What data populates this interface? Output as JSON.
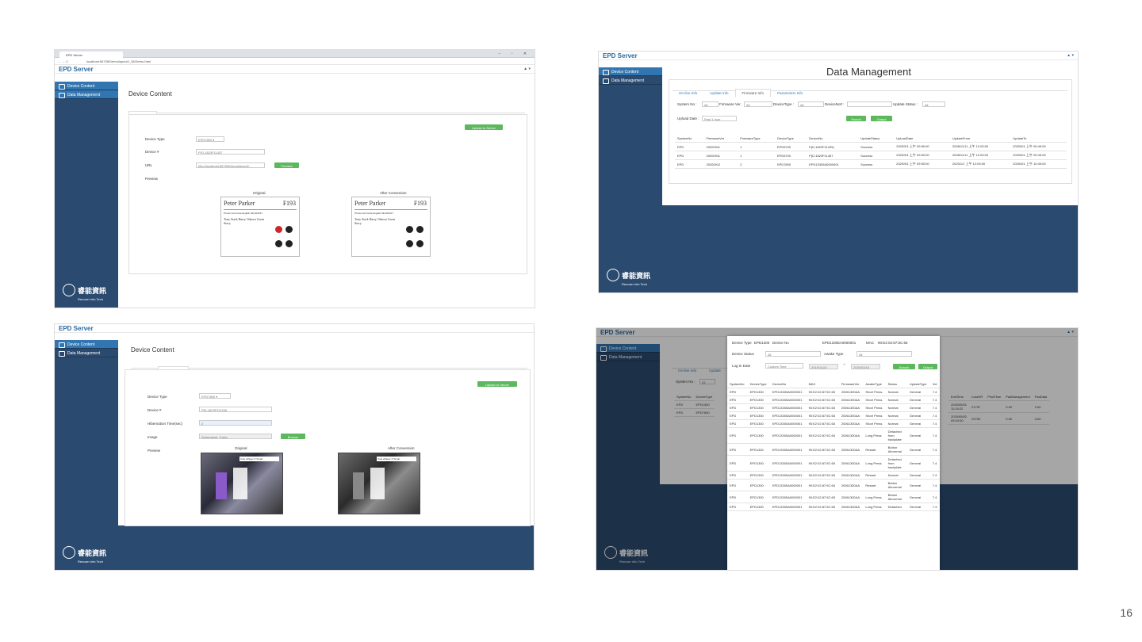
{
  "shot1": {
    "tab_title": "EPD Server",
    "url": "localhost:56759/Demo/layout2_28/Demo.html",
    "window_controls": "− ▫ ✕",
    "brand": "EPD Server",
    "user_icon": "▲ ▾",
    "sidebar": [
      "Device Content",
      "Data Management"
    ],
    "title": "Device Content",
    "tabs": [
      "By HTTP",
      "By IMAGE"
    ],
    "upload_button": "Upload to Server",
    "labels": [
      "Device Type",
      "Device #",
      "URL",
      "Preview"
    ],
    "device_type": "EPD7800 ▾",
    "device_no": "P(D-1823F11457",
    "url_value": "http://localhost:56759/Demo/layout2...",
    "preview_button": "Preview",
    "original_caption": "Original",
    "after_caption": "After Conversion",
    "card": {
      "name": "Peter Parker",
      "number": "₣193",
      "row_text": "Ph-fee   Full Code   English   09/13/2017",
      "names": "Tony Stark   Harry Osborn   Gwen Stacy"
    },
    "logo_zh": "睿能資訊",
    "logo_en": "Renown Info Tech"
  },
  "shot2": {
    "brand": "EPD Server",
    "user_icon": "▲ ▾",
    "sidebar": [
      "Device Content",
      "Data Management"
    ],
    "title": "Data Management",
    "tabs": [
      "On-line Info",
      "Update Info",
      "Firmware Info",
      "Parameters Info"
    ],
    "filter_labels": {
      "system": "System No :",
      "firmware": "Firmware Ver.",
      "device_type": "DeviceType :",
      "device_no": "DeviceNo# :",
      "update_status": "Update Status :",
      "upload_date": "Upload Date :"
    },
    "filter_values": {
      "all": "All",
      "upload_date": "Past 1 hour"
    },
    "search_button": "Search",
    "output_button": "Output",
    "columns": [
      "SystemNo",
      "FirmwareVer",
      "FirmwareType",
      "DeviceType",
      "DeviceNo",
      "UpdateStatus",
      "UploadDate",
      "UpdateFrom",
      "UpdateTo"
    ],
    "rows": [
      [
        "EPD",
        "20200911",
        "1",
        "EPD5700",
        "P(D-1823F11205)",
        "Success",
        "2020/5/1 上午 09:50:00",
        "2008/11/11 上午 12:00:00",
        "2020/5/1 上午 09:49:00"
      ],
      [
        "EPD",
        "20200911",
        "1",
        "EPD5700",
        "P(D-1823F11457",
        "Success",
        "2020/5/1 上午 09:50:00",
        "2008/11/11 上午 12:00:00",
        "2020/5/1 上午 09:49:00"
      ],
      [
        "EPD",
        "20200912",
        "2",
        "EPD7800",
        "EPD13305A0000001",
        "Success",
        "2020/5/1 上午 09:50:00",
        "2020/1/1 上午 12:00:00",
        "2020/5/1 上午 10:49:00"
      ]
    ],
    "logo_zh": "睿能資訊",
    "logo_en": "Renown Info Tech"
  },
  "shot3": {
    "brand": "EPD Server",
    "sidebar": [
      "Device Content",
      "Data Management"
    ],
    "title": "Device Content",
    "tabs": [
      "By HTTP",
      "By IMAGE"
    ],
    "upload_button": "Upload to Server",
    "labels": [
      "Device Type",
      "Device #",
      "Hibernation Time(sec)",
      "Image",
      "Preview"
    ],
    "device_type": "EPD7800 ▾",
    "device_no": "PiD-1823F311206",
    "hibernation": "2",
    "image_value": "Screenshot_5.png",
    "browse_button": "Browse",
    "original_caption": "Original",
    "after_caption": "After Conversion",
    "banner": "Cole ePaper X Smart Transportation",
    "logo_zh": "睿能資訊",
    "logo_en": "Renown Info Tech"
  },
  "shot4": {
    "brand": "EPD Server",
    "user_icon": "▲ ▾",
    "sidebar": [
      "Device Content",
      "Data Management"
    ],
    "bg_tabs": [
      "On-line Info",
      "Update"
    ],
    "bg_system": "System No :",
    "bg_all": "All",
    "bg_columns": [
      "SystemNo",
      "DeviceType"
    ],
    "bg_rows": [
      [
        "EPD",
        "EPD1300"
      ],
      [
        "EPD",
        "EPD7800"
      ]
    ],
    "bg_right_columns": [
      "EndTime",
      "LossHR",
      "PhotTime",
      "PadManagement",
      "PadData"
    ],
    "bg_right_rows": [
      [
        "2020/05/01 11:19:22",
        "21797",
        "",
        "0.00",
        "0.00"
      ],
      [
        "2020/05/02 09:43:00",
        "29753",
        "",
        "0.00",
        "0.00"
      ]
    ],
    "modal": {
      "device_type_label": "Device Type",
      "device_type": "EPD1300",
      "device_no_label": "Device No",
      "device_no": "EPD13305A0000001",
      "mac_label": "MAC",
      "mac": "90:E2:02:87:5C:65",
      "status_label": "Device Status",
      "status_value": "All",
      "awake_label": "Awake Type",
      "awake_value": "All",
      "login_label": "Log In Date",
      "login_value": "Custom Time",
      "date_from": "2019/11/24",
      "date_sep": "~",
      "date_to": "2020/03/16",
      "search_button": "Search",
      "output_button": "Output",
      "columns": [
        "SystemNo",
        "DeviceType",
        "DeviceNo",
        "MAC",
        "FirmwareVer",
        "AwakeType",
        "Status",
        "UpdateType",
        "Vol"
      ],
      "rows": [
        [
          "EPD",
          "EPD1300",
          "EPD13305A0000001",
          "90:E2:02:87:5C:65",
          "20061300AA",
          "Short Press",
          "Normal",
          "General",
          "7.4"
        ],
        [
          "EPD",
          "EPD1300",
          "EPD13305A0000001",
          "90:E2:02:87:5C:65",
          "20061300AA",
          "Short Press",
          "Normal",
          "General",
          "7.4"
        ],
        [
          "EPD",
          "EPD1300",
          "EPD13305A0000001",
          "90:E2:02:87:5C:65",
          "20061300AA",
          "Short Press",
          "Normal",
          "General",
          "7.4"
        ],
        [
          "EPD",
          "EPD1300",
          "EPD13305A0000001",
          "90:E2:02:87:5C:65",
          "20061300AA",
          "Short Press",
          "Normal",
          "General",
          "7.4"
        ],
        [
          "EPD",
          "EPD1300",
          "EPD13305A0000001",
          "90:E2:02:87:5C:65",
          "20061300AA",
          "Short Press",
          "Normal",
          "General",
          "7.4"
        ],
        [
          "EPD",
          "EPD1300",
          "EPD13305A0000001",
          "90:E2:02:87:5C:65",
          "20061300AA",
          "Long Press",
          "Detached from backplate",
          "General",
          "7.4"
        ],
        [
          "EPD",
          "EPD1300",
          "EPD13305A0000001",
          "90:E2:02:87:5C:65",
          "20061300AA",
          "Restart",
          "Button Abnormal",
          "General",
          "7.4"
        ],
        [
          "EPD",
          "EPD1300",
          "EPD13305A0000001",
          "90:E2:02:87:5C:65",
          "20061300AA",
          "Long Press",
          "Detached from backplate",
          "General",
          "7.4"
        ],
        [
          "EPD",
          "EPD1300",
          "EPD13305A0000001",
          "90:E2:02:87:5C:65",
          "20061300AA",
          "Restart",
          "Normal",
          "General",
          "7.4"
        ],
        [
          "EPD",
          "EPD1300",
          "EPD13305A0000001",
          "90:E2:02:87:5C:65",
          "20061300AA",
          "Restart",
          "Button Abnormal",
          "General",
          "7.4"
        ],
        [
          "EPD",
          "EPD1300",
          "EPD13305A0000001",
          "90:E2:02:87:5C:65",
          "20061300AA",
          "Long Press",
          "Button Abnormal",
          "General",
          "7.4"
        ],
        [
          "EPD",
          "EPD1300",
          "EPD13305A0000001",
          "90:E2:02:87:5C:65",
          "20061300AA",
          "Long Press",
          "Detached",
          "General",
          "7.4"
        ]
      ]
    },
    "logo_zh": "睿能資訊",
    "logo_en": "Renown Info Tech"
  },
  "page_number": "16"
}
